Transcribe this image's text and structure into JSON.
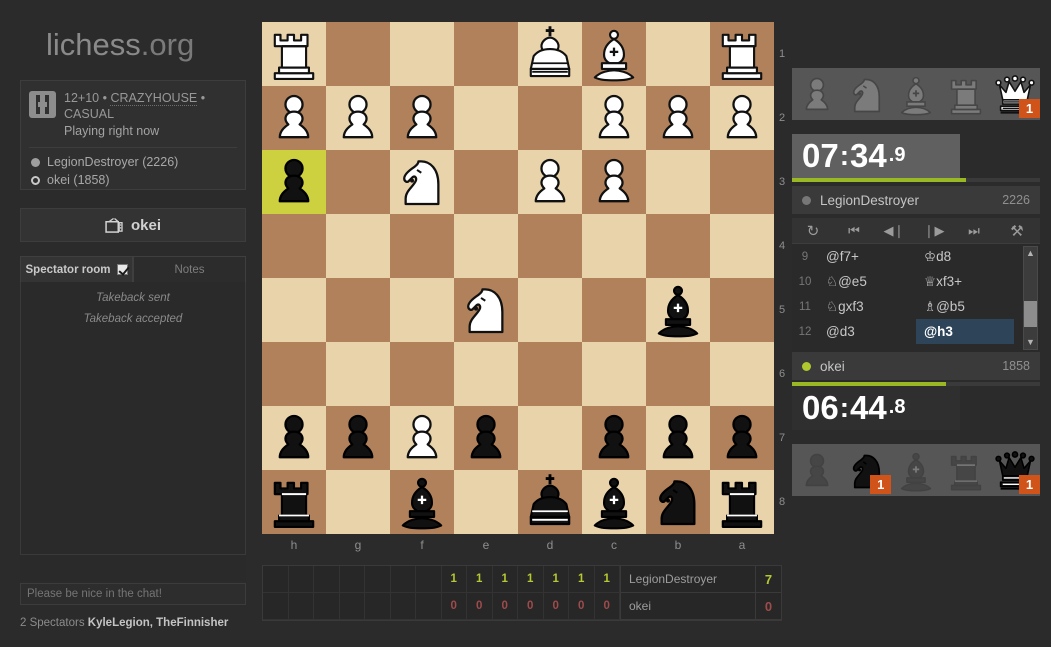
{
  "site": {
    "name_main": "lichess",
    "name_tld": ".org"
  },
  "game_info": {
    "icon": "crazyhouse-variant-icon",
    "time_control": "12+10",
    "sep1": " • ",
    "variant": "CRAZYHOUSE",
    "sep2": " • ",
    "mode": "CASUAL",
    "status": "Playing right now",
    "players": [
      {
        "color": "white",
        "label": "LegionDestroyer (2226)"
      },
      {
        "color": "black",
        "label": "okei (1858)"
      }
    ]
  },
  "tv_button": {
    "icon": "tv-icon",
    "label": "okei"
  },
  "chat": {
    "tabs": [
      {
        "label": "Spectator room",
        "active": true,
        "has_checkbox": true
      },
      {
        "label": "Notes",
        "active": false,
        "has_checkbox": false
      }
    ],
    "messages": [
      "Takeback sent",
      "Takeback accepted"
    ],
    "input_placeholder": "Please be nice in the chat!",
    "input_value": ""
  },
  "spectators": {
    "count_label": "2 Spectators",
    "names": "KyleLegion, TheFinnisher"
  },
  "board": {
    "orientation": "black",
    "files": [
      "h",
      "g",
      "f",
      "e",
      "d",
      "c",
      "b",
      "a"
    ],
    "ranks": [
      "1",
      "2",
      "3",
      "4",
      "5",
      "6",
      "7",
      "8"
    ],
    "light_color": "#e9d3ab",
    "dark_color": "#b0815b",
    "highlight_color": "#cdd03f",
    "highlighted_squares": [
      "0,2"
    ],
    "pieces": [
      {
        "cell": "0,0",
        "color": "w",
        "type": "rook"
      },
      {
        "cell": "4,0",
        "color": "w",
        "type": "king"
      },
      {
        "cell": "5,0",
        "color": "w",
        "type": "bishop"
      },
      {
        "cell": "7,0",
        "color": "w",
        "type": "rook"
      },
      {
        "cell": "0,1",
        "color": "w",
        "type": "pawn"
      },
      {
        "cell": "1,1",
        "color": "w",
        "type": "pawn"
      },
      {
        "cell": "2,1",
        "color": "w",
        "type": "pawn"
      },
      {
        "cell": "5,1",
        "color": "w",
        "type": "pawn"
      },
      {
        "cell": "6,1",
        "color": "w",
        "type": "pawn"
      },
      {
        "cell": "7,1",
        "color": "w",
        "type": "pawn"
      },
      {
        "cell": "0,2",
        "color": "b",
        "type": "pawn"
      },
      {
        "cell": "2,2",
        "color": "w",
        "type": "knight"
      },
      {
        "cell": "4,2",
        "color": "w",
        "type": "pawn"
      },
      {
        "cell": "5,2",
        "color": "w",
        "type": "pawn"
      },
      {
        "cell": "3,4",
        "color": "w",
        "type": "knight"
      },
      {
        "cell": "6,4",
        "color": "b",
        "type": "bishop"
      },
      {
        "cell": "0,6",
        "color": "b",
        "type": "pawn"
      },
      {
        "cell": "1,6",
        "color": "b",
        "type": "pawn"
      },
      {
        "cell": "2,6",
        "color": "w",
        "type": "pawn"
      },
      {
        "cell": "3,6",
        "color": "b",
        "type": "pawn"
      },
      {
        "cell": "5,6",
        "color": "b",
        "type": "pawn"
      },
      {
        "cell": "6,6",
        "color": "b",
        "type": "pawn"
      },
      {
        "cell": "7,6",
        "color": "b",
        "type": "pawn"
      },
      {
        "cell": "0,7",
        "color": "b",
        "type": "rook"
      },
      {
        "cell": "2,7",
        "color": "b",
        "type": "bishop"
      },
      {
        "cell": "4,7",
        "color": "b",
        "type": "king"
      },
      {
        "cell": "5,7",
        "color": "b",
        "type": "bishop"
      },
      {
        "cell": "6,7",
        "color": "b",
        "type": "knight"
      },
      {
        "cell": "7,7",
        "color": "b",
        "type": "rook"
      }
    ]
  },
  "crosstable": {
    "empty_cells": 7,
    "rows": [
      {
        "name": "LegionDestroyer",
        "results": [
          "1",
          "1",
          "1",
          "1",
          "1",
          "1",
          "1"
        ],
        "points": "7",
        "style": "win"
      },
      {
        "name": "okei",
        "results": [
          "0",
          "0",
          "0",
          "0",
          "0",
          "0",
          "0"
        ],
        "points": "0",
        "style": "loss"
      }
    ]
  },
  "right_panel": {
    "white_pocket": [
      {
        "type": "pawn",
        "count": null
      },
      {
        "type": "knight",
        "count": null
      },
      {
        "type": "bishop",
        "count": null
      },
      {
        "type": "rook",
        "count": null
      },
      {
        "type": "queen",
        "count": "1"
      }
    ],
    "black_pocket": [
      {
        "type": "pawn",
        "count": null
      },
      {
        "type": "knight",
        "count": "1"
      },
      {
        "type": "bishop",
        "count": null
      },
      {
        "type": "rook",
        "count": null
      },
      {
        "type": "queen",
        "count": "1"
      }
    ],
    "top_clock": {
      "minutes": "07",
      "separator": ":",
      "seconds": "34",
      "tenths": ".9",
      "bar_percent": 70
    },
    "bottom_clock": {
      "minutes": "06",
      "separator": ":",
      "seconds": "44",
      "tenths": ".8",
      "bar_percent": 62
    },
    "top_player": {
      "name": "LegionDestroyer",
      "rating": "2226",
      "dot": "grey"
    },
    "bottom_player": {
      "name": "okei",
      "rating": "1858",
      "dot": "green"
    },
    "nav_buttons": [
      {
        "icon": "flip-board-icon",
        "glyph": "↻"
      },
      {
        "icon": "first-move-icon",
        "glyph": "⏮"
      },
      {
        "icon": "previous-move-icon",
        "glyph": "◀❘"
      },
      {
        "icon": "next-move-icon",
        "glyph": "❘▶"
      },
      {
        "icon": "last-move-icon",
        "glyph": "⏭"
      },
      {
        "icon": "analysis-board-icon",
        "glyph": "⚒"
      }
    ],
    "moves": [
      {
        "number": "9",
        "white": "@f7+",
        "black": "♔d8",
        "active": null
      },
      {
        "number": "10",
        "white": "♘@e5",
        "black": "♕xf3+",
        "active": null
      },
      {
        "number": "11",
        "white": "♘gxf3",
        "black": "♗@b5",
        "active": null
      },
      {
        "number": "12",
        "white": "@d3",
        "black": "@h3",
        "active": "black"
      }
    ]
  }
}
